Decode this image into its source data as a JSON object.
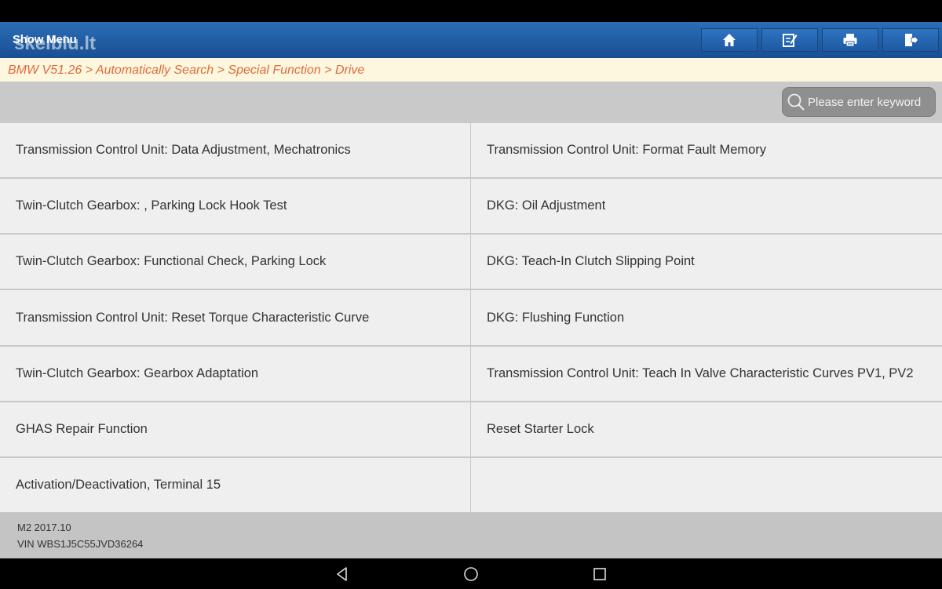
{
  "header": {
    "show_menu_label": "Show Menu",
    "watermark": "skelbiu.lt",
    "toolbar": [
      {
        "icon": "home-icon"
      },
      {
        "icon": "edit-icon"
      },
      {
        "icon": "print-icon"
      },
      {
        "icon": "exit-icon"
      }
    ]
  },
  "breadcrumb": "BMW V51.26 > Automatically Search > Special Function > Drive",
  "search": {
    "placeholder": "Please enter keyword"
  },
  "functions": [
    [
      "Transmission Control Unit: Data Adjustment, Mechatronics",
      "Transmission Control Unit: Format Fault Memory"
    ],
    [
      "Twin-Clutch Gearbox: , Parking Lock Hook Test",
      "DKG: Oil Adjustment"
    ],
    [
      "Twin-Clutch Gearbox: Functional Check, Parking Lock",
      "DKG: Teach-In Clutch Slipping Point"
    ],
    [
      "Transmission Control Unit: Reset Torque Characteristic Curve",
      "DKG: Flushing Function"
    ],
    [
      "Twin-Clutch Gearbox: Gearbox Adaptation",
      "Transmission Control Unit: Teach In Valve Characteristic Curves PV1, PV2"
    ],
    [
      "GHAS Repair Function",
      "Reset Starter Lock"
    ],
    [
      "Activation/Deactivation, Terminal 15",
      ""
    ]
  ],
  "footer": {
    "model": "M2 2017.10",
    "vin": "VIN WBS1J5C55JVD36264"
  },
  "navigation": [
    {
      "icon": "back-icon"
    },
    {
      "icon": "home-circle-icon"
    },
    {
      "icon": "recent-apps-icon"
    }
  ],
  "colors": {
    "header": "#1f5aa0",
    "breadcrumb_text": "#e06a3a",
    "cell_background": "#efefef",
    "grid_lines": "#c8c8c8"
  }
}
